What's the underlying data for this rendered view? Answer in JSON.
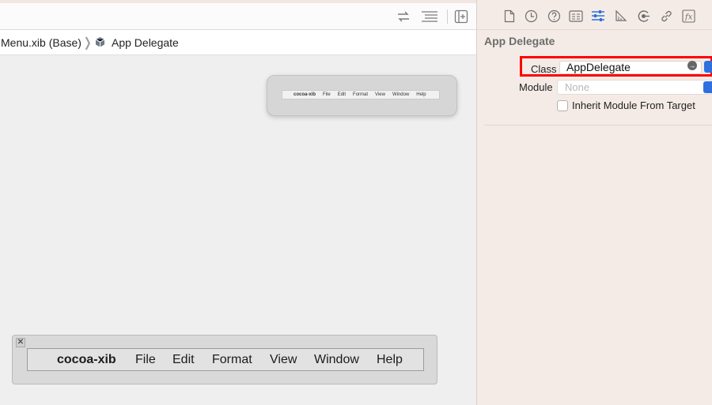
{
  "breadcrumb": {
    "file": "Menu.xib (Base)",
    "item": "App Delegate"
  },
  "mini_menu": {
    "items": [
      "cocoa-xib",
      "File",
      "Edit",
      "Format",
      "View",
      "Window",
      "Help"
    ]
  },
  "main_menu": {
    "items": [
      "cocoa-xib",
      "File",
      "Edit",
      "Format",
      "View",
      "Window",
      "Help"
    ]
  },
  "inspector": {
    "title": "App Delegate",
    "class_label": "Class",
    "class_value": "AppDelegate",
    "module_label": "Module",
    "module_placeholder": "None",
    "inherit_label": "Inherit Module From Target",
    "inherit_checked": false
  },
  "colors": {
    "highlight": "#ff0000",
    "accent": "#2f6fe0"
  }
}
